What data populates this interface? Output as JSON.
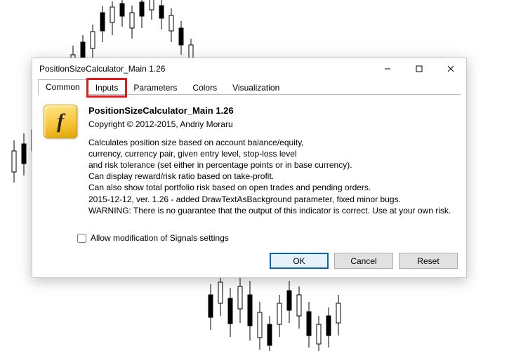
{
  "dialog": {
    "title": "PositionSizeCalculator_Main 1.26",
    "tabs": [
      "Common",
      "Inputs",
      "Parameters",
      "Colors",
      "Visualization"
    ],
    "active_tab_index": 0,
    "highlighted_tab_index": 1,
    "icon_glyph": "f",
    "app_title": "PositionSizeCalculator_Main 1.26",
    "copyright": "Copyright © 2012-2015, Andriy Moraru",
    "desc_lines": [
      "Calculates position size based on account balance/equity,",
      "currency, currency pair, given entry level, stop-loss level",
      "and risk tolerance (set either in percentage points or in base currency).",
      "Can display reward/risk ratio based on take-profit.",
      "Can also show total portfolio risk based on open trades and pending orders.",
      "2015-12-12, ver. 1.26 - added DrawTextAsBackground parameter, fixed minor bugs.",
      "WARNING: There is no guarantee that the output of this indicator is correct. Use at your own risk."
    ],
    "allow_label": "Allow modification of Signals settings",
    "allow_checked": false,
    "buttons": {
      "ok": "OK",
      "cancel": "Cancel",
      "reset": "Reset"
    }
  }
}
